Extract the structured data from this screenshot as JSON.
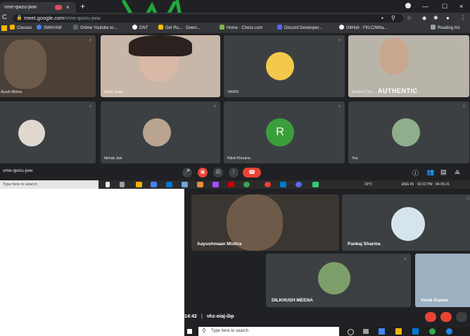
{
  "browser": {
    "tab_title": "vme-qwzu-jww",
    "tab_close": "×",
    "new_tab": "+",
    "nav_glyph": "C",
    "address_host": "meet.google.com",
    "address_path": "/vme-qwzu-jww",
    "window_buttons": [
      "—",
      "☐",
      "×"
    ],
    "bookmarks": [
      {
        "label": "Classes",
        "color": "#f4b400"
      },
      {
        "label": "SWAYAM",
        "color": "#4285f4"
      },
      {
        "label": "Online Youtube to...",
        "color": "#5f6368"
      },
      {
        "label": "DNT",
        "color": "#ffffff"
      },
      {
        "label": "Get Ru... · Down...",
        "color": "#fbbc04"
      },
      {
        "label": "Home · Chess.com",
        "color": "#81b64c"
      },
      {
        "label": "Discord Developer...",
        "color": "#5865f2"
      },
      {
        "label": "GitHub · FKLC/Wha...",
        "color": "#ffffff"
      }
    ],
    "reading_list": "Reading list"
  },
  "meet_top": {
    "participants": [
      {
        "name": "Ayush Mishra",
        "kind": "video",
        "tone": "#6b5a4a"
      },
      {
        "name": "Disha Tyagi",
        "kind": "video",
        "tone": "#d9b8a6"
      },
      {
        "name": "YAYATI",
        "kind": "avatar",
        "avatar_bg": "#f2c94c"
      },
      {
        "name": "Akhilesh Cha...",
        "kind": "video",
        "tone": "#c9c3b7"
      },
      {
        "name": "",
        "kind": "avatar",
        "avatar_bg": "#e0d8ce"
      },
      {
        "name": "Mehak Jain",
        "kind": "avatar",
        "avatar_bg": "#b9a48f"
      },
      {
        "name": "Nitish Khurana",
        "kind": "letter",
        "letter": "R",
        "avatar_bg": "#3a9f3a"
      },
      {
        "name": "You",
        "kind": "avatar",
        "avatar_bg": "#8fae8c"
      }
    ],
    "meeting_code": "vme-qwzu-jww",
    "authentic_overlay": "AUTHENTIC"
  },
  "taskbar_top": {
    "search_placeholder": "Type here to search",
    "weather": "33°C",
    "lang": "ENG IN",
    "time": "02:22 PM",
    "date": "04-09-21"
  },
  "meet_bottom": {
    "participants": [
      {
        "name": "Aayushmaan Mishra"
      },
      {
        "name": "Pankaj Sharma"
      },
      {
        "name": "DILKHUSH MEENA"
      },
      {
        "name": "Vivek Kumar"
      }
    ],
    "time": "14:42",
    "separator": "|",
    "meeting_code": "vhz-oiaj-ibp"
  },
  "taskbar_bottom": {
    "search_placeholder": "Type here to search"
  },
  "colors": {
    "meet_bg": "#202124",
    "tile_bg": "#3c4043",
    "end_call": "#ea4335"
  }
}
